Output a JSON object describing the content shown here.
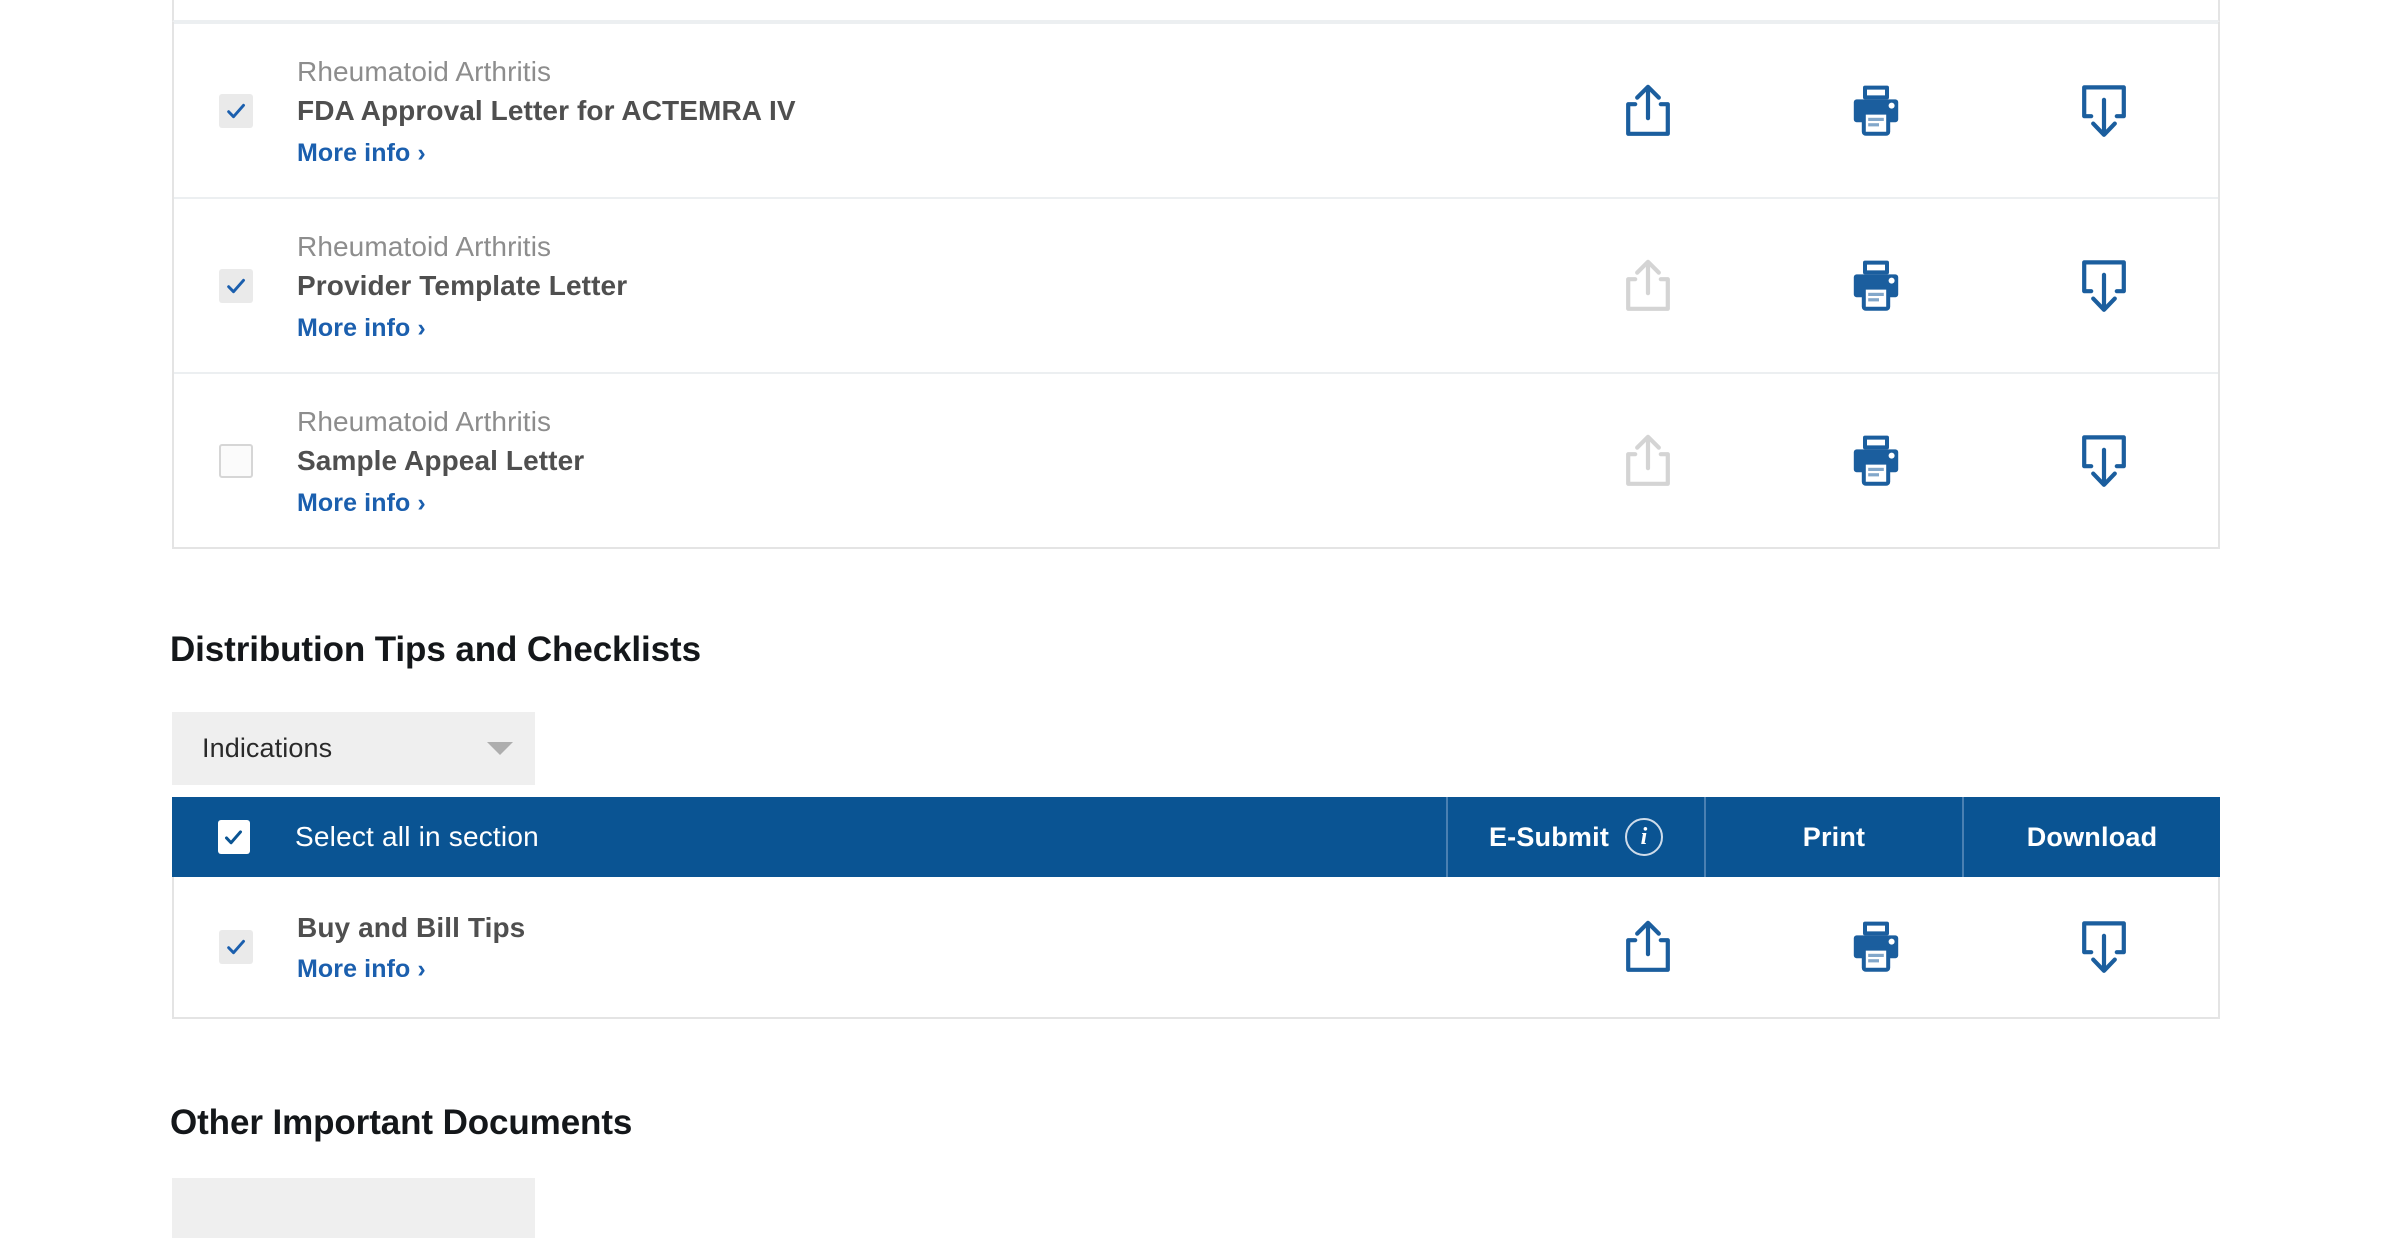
{
  "colors": {
    "brand_blue": "#0a5493",
    "icon_blue": "#1b5e9e",
    "icon_disabled": "#d4d4d4",
    "link_blue": "#1b5fae",
    "category_gray": "#8d8d8d",
    "title_gray": "#4f4f4f",
    "checkbox_fill": "#eaeaea",
    "filter_bg": "#efefef",
    "row_border": "#eceff1"
  },
  "documents_table": {
    "rows": [
      {
        "category": "Rheumatoid Arthritis",
        "title": "FDA Approval Letter for ACTEMRA IV",
        "more_info": "More info ›",
        "checked": true,
        "esubmit_enabled": true,
        "print_enabled": true,
        "download_enabled": true
      },
      {
        "category": "Rheumatoid Arthritis",
        "title": "Provider Template Letter",
        "more_info": "More info ›",
        "checked": true,
        "esubmit_enabled": false,
        "print_enabled": true,
        "download_enabled": true
      },
      {
        "category": "Rheumatoid Arthritis",
        "title": "Sample Appeal Letter",
        "more_info": "More info ›",
        "checked": false,
        "esubmit_enabled": false,
        "print_enabled": true,
        "download_enabled": true
      }
    ]
  },
  "distribution_section": {
    "heading": "Distribution Tips and Checklists",
    "filter": {
      "selected": "Indications",
      "icon": "chevron-down-icon"
    },
    "action_bar": {
      "select_all_label": "Select all in section",
      "select_all_checked": true,
      "esubmit_label": "E-Submit",
      "esubmit_info_icon": "info-icon",
      "print_label": "Print",
      "download_label": "Download"
    },
    "rows": [
      {
        "category": "",
        "title": "Buy and Bill Tips",
        "more_info": "More info ›",
        "checked": true,
        "esubmit_enabled": true,
        "print_enabled": true,
        "download_enabled": true
      }
    ]
  },
  "other_section": {
    "heading": "Other Important Documents",
    "filter": {
      "selected": "",
      "icon": "chevron-down-icon"
    }
  }
}
